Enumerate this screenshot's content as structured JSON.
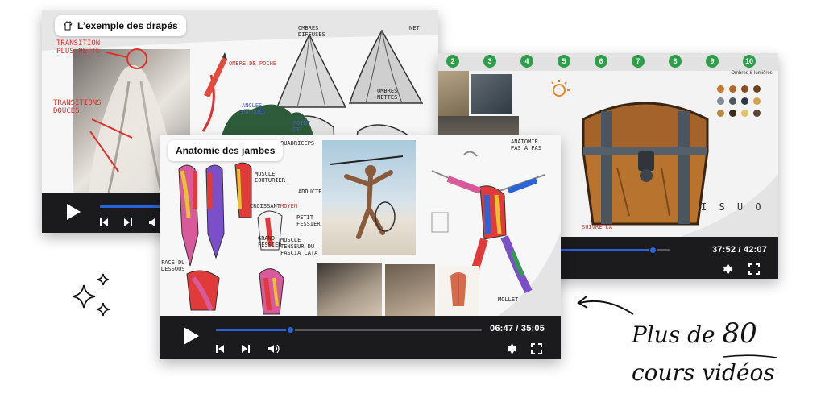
{
  "players": {
    "drapes": {
      "title": "L’exemple des drapés",
      "annotations": {
        "transition_nette": "TRANSITION PLUS NETTE",
        "transitions_douces": "TRANSITIONS DOUCES",
        "ombre_poche": "OMBRE DE POCHE",
        "ombres_diffuses": "OMBRES DIFFUSES",
        "net": "NET",
        "ombres_nettes": "OMBRES NETTES",
        "angles_marques": "ANGLES MARQUÉS",
        "point_de": "POINT DE"
      }
    },
    "chest": {
      "steps": [
        "2",
        "3",
        "4",
        "5",
        "6",
        "7",
        "8",
        "9",
        "10"
      ],
      "palette_title": "Ombres & lumières",
      "annotation_suivre": "SUIVRE LA",
      "time": "37:52 / 42:07",
      "progress": 0.85,
      "letters": "I S U O"
    },
    "jambes": {
      "title": "Anatomie des jambes",
      "annotations": {
        "quadriceps": "QUADRICEPS",
        "muscle_couturier": "MUSCLE COUTURIER",
        "adducteurs": "ADDUCTEURS",
        "croissant": "CROISSANT",
        "moyen": "MOYEN",
        "petit_fessier": "PETIT FESSIER",
        "grand_fessier": "GRAND FESSIER",
        "muscle_tenseur": "MUSCLE TENSEUR DU FASCIA LATA",
        "face_dessous": "FACE DU DESSOUS",
        "anatomie_pas": "ANATOMIE PAS À PAS",
        "mollet": "MOLLET"
      },
      "time": "06:47 / 35:05",
      "progress": 0.28
    }
  },
  "tagline": {
    "line1_prefix": "Plus de",
    "line1_number": "80",
    "line2": "cours vidéos"
  }
}
